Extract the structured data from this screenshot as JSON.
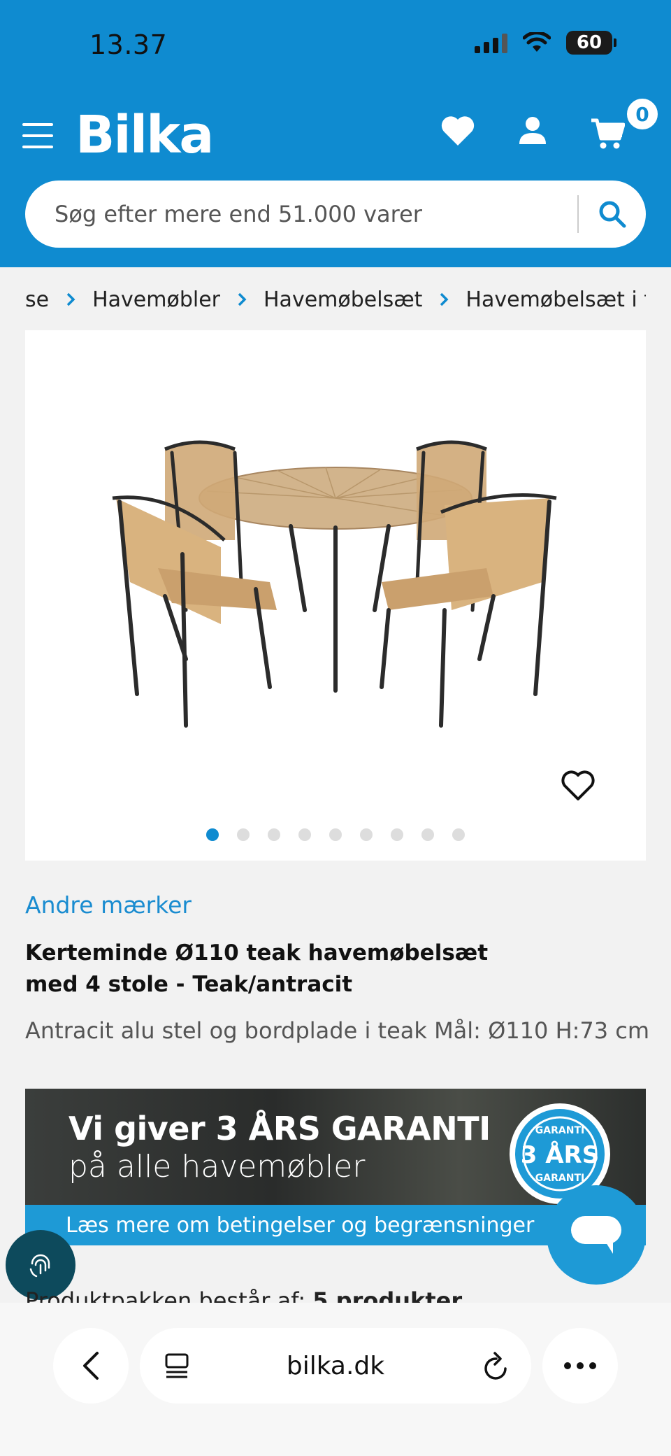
{
  "status_bar": {
    "time": "13.37",
    "battery": "60"
  },
  "header": {
    "logo": "Bilka",
    "cart_count": "0",
    "search_placeholder": "Søg efter mere end 51.000 varer",
    "brand_color": "#0f8bd0"
  },
  "breadcrumb": [
    "se",
    "Havemøbler",
    "Havemøbelsæt",
    "Havemøbelsæt i træ"
  ],
  "gallery": {
    "total_images": 9,
    "active_index": 0
  },
  "product": {
    "brand": "Andre mærker",
    "title": "Kerteminde Ø110 teak havemøbelsæt med 4 stole - Teak/antracit",
    "subtitle": "Antracit alu stel og bordplade i teak Mål: Ø110 H:73 cm"
  },
  "banner": {
    "line1": "Vi giver 3 ÅRS GARANTI",
    "line2": "på alle havemøbler",
    "link": "Læs mere om betingelser og begrænsninger",
    "badge_top": "GARANTI",
    "badge_main": "3 ÅRS",
    "badge_bottom": "GARANTI"
  },
  "package": {
    "prefix": "Produktpakken består af:",
    "count": "5 produkter"
  },
  "browser": {
    "url": "bilka.dk"
  }
}
